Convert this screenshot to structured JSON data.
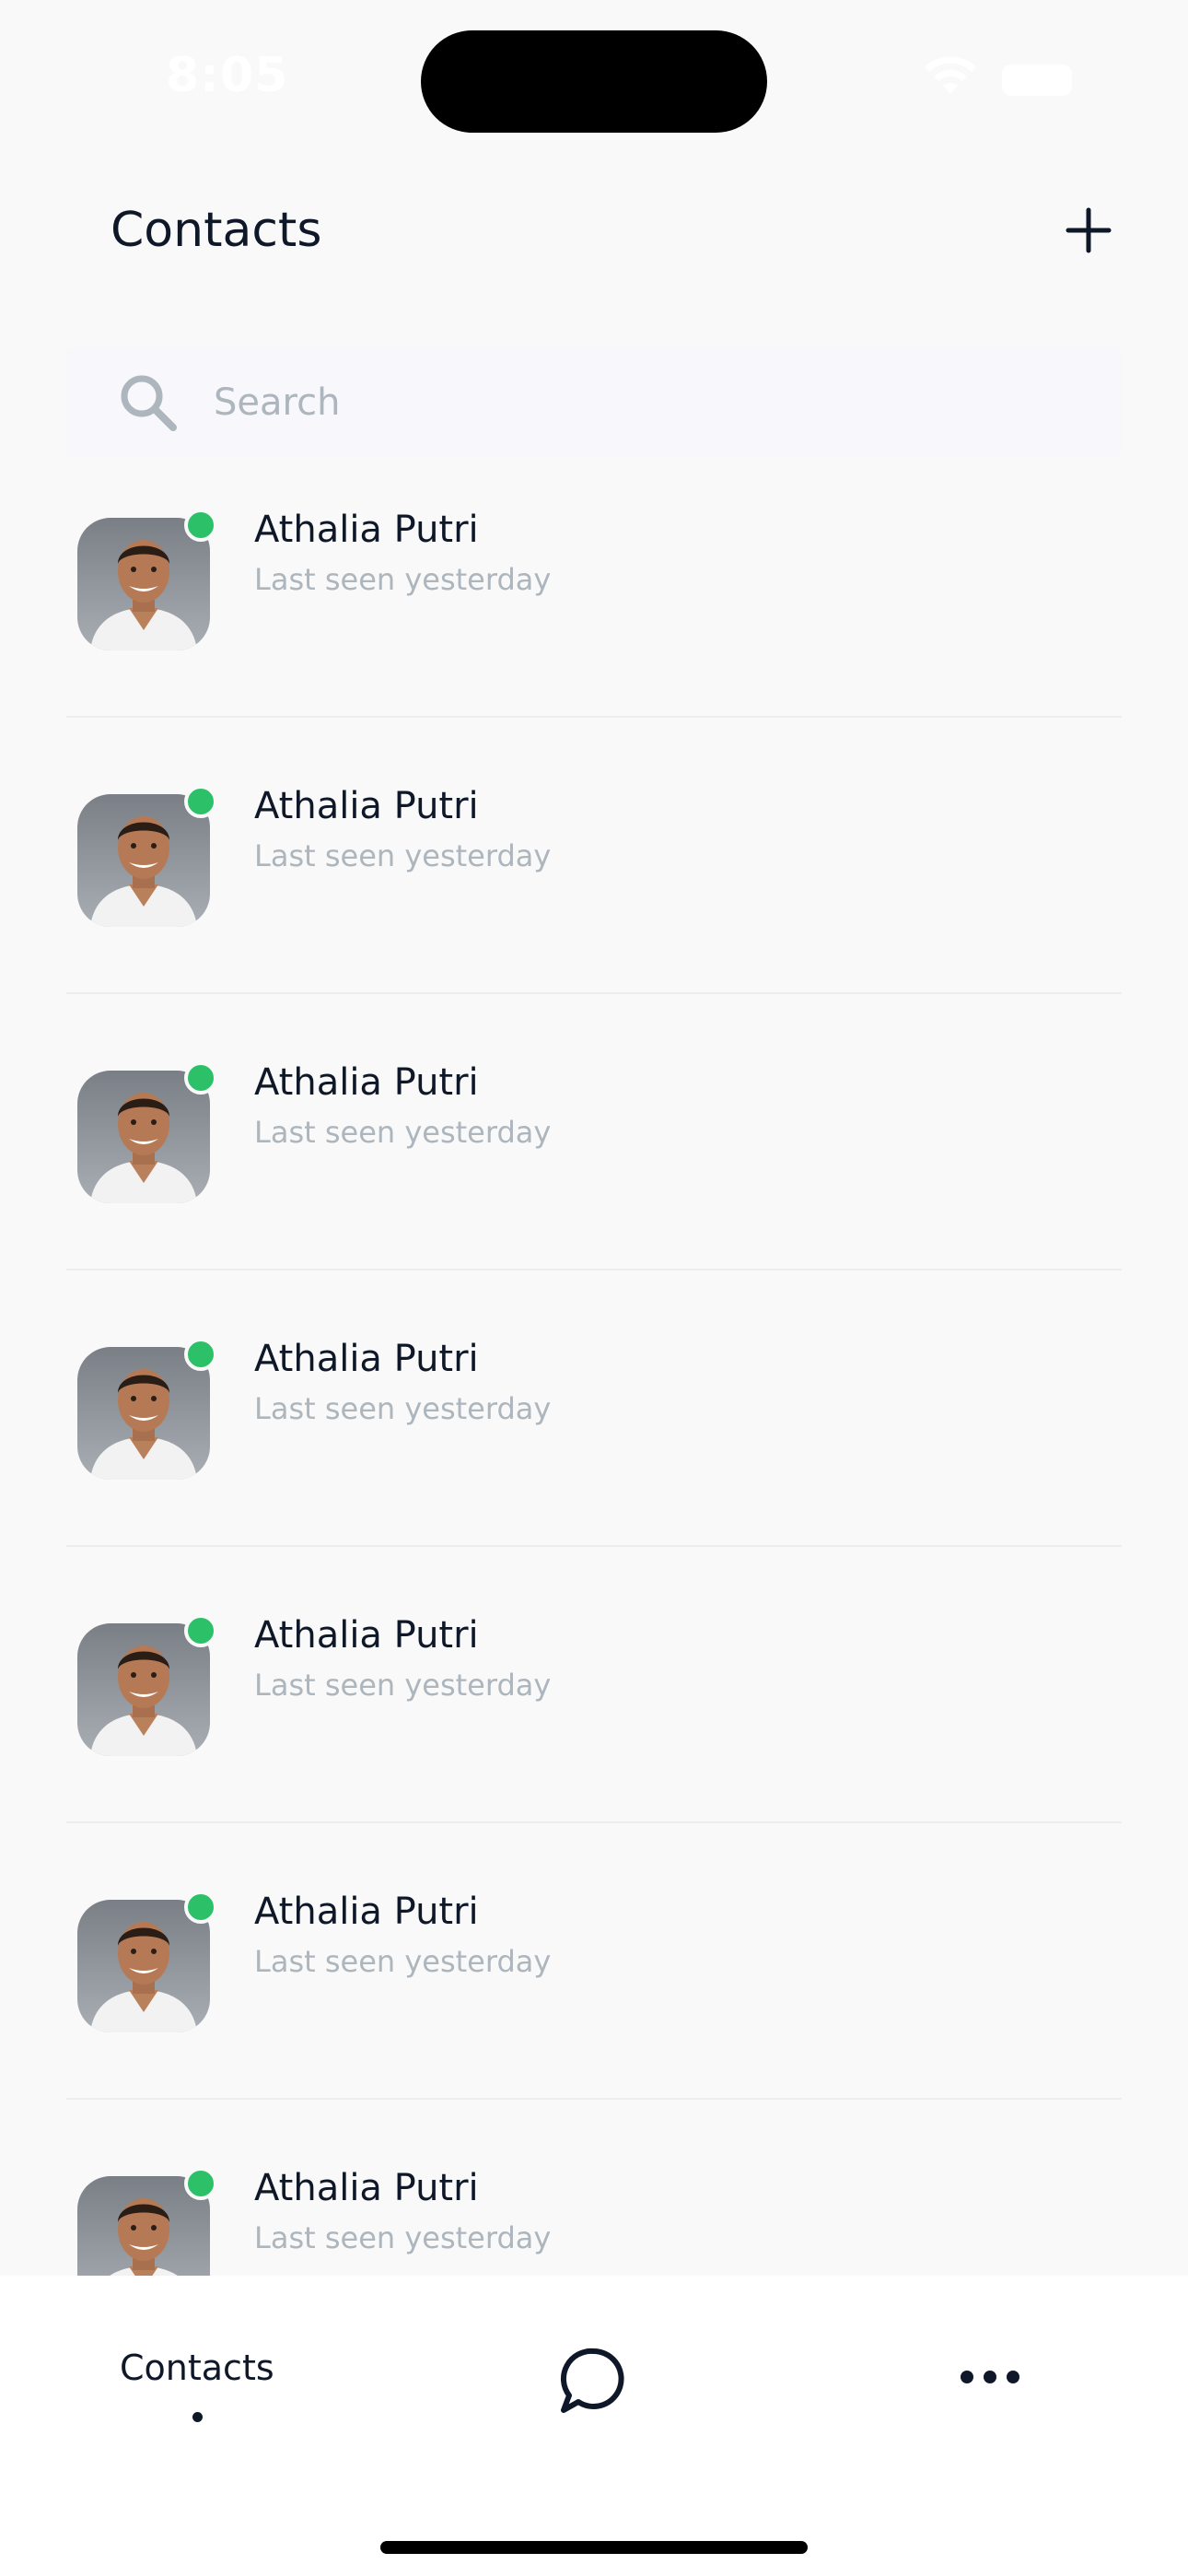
{
  "status_bar": {
    "time": "8:05"
  },
  "header": {
    "title": "Contacts",
    "add_icon": "plus-icon"
  },
  "search": {
    "placeholder": "Search",
    "value": "",
    "icon": "search-icon"
  },
  "contacts": [
    {
      "name": "Athalia Putri",
      "status": "Last seen yesterday",
      "online": true
    },
    {
      "name": "Athalia Putri",
      "status": "Last seen yesterday",
      "online": true
    },
    {
      "name": "Athalia Putri",
      "status": "Last seen yesterday",
      "online": true
    },
    {
      "name": "Athalia Putri",
      "status": "Last seen yesterday",
      "online": true
    },
    {
      "name": "Athalia Putri",
      "status": "Last seen yesterday",
      "online": true
    },
    {
      "name": "Athalia Putri",
      "status": "Last seen yesterday",
      "online": true
    },
    {
      "name": "Athalia Putri",
      "status": "Last seen yesterday",
      "online": true
    }
  ],
  "bottom_nav": {
    "contacts_label": "Contacts",
    "chats_icon": "chat-bubble-icon",
    "more_icon": "more-icon"
  },
  "colors": {
    "online": "#2CC069",
    "text_primary": "#0F1828",
    "text_secondary": "#ADB5BD",
    "background": "#F9F9F9"
  }
}
